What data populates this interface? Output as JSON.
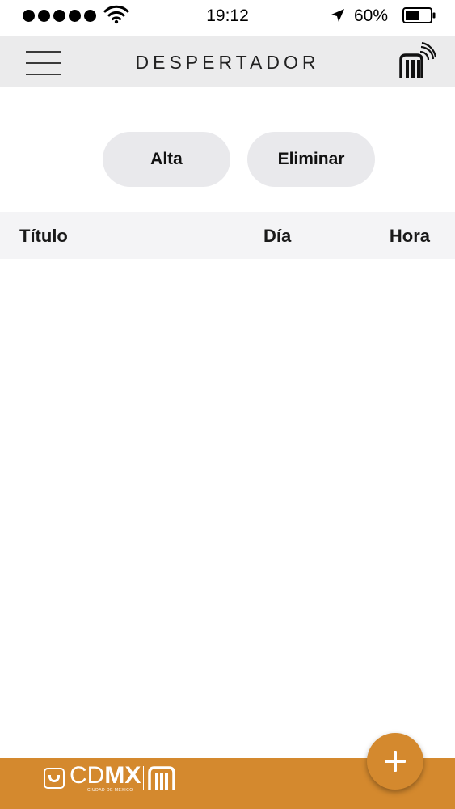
{
  "status_bar": {
    "signal_dots": 5,
    "time": "19:12",
    "battery_percent": "60%",
    "battery_level": 0.6,
    "icons": [
      "signal-dots-icon",
      "wifi-icon",
      "location-arrow-icon",
      "battery-icon"
    ]
  },
  "nav_bar": {
    "title": "DESPERTADOR",
    "menu_icon": "hamburger-menu-icon",
    "logo_icon": "metro-logo-icon",
    "background": "#ebebec"
  },
  "actions": {
    "alta_label": "Alta",
    "eliminar_label": "Eliminar"
  },
  "table": {
    "columns": [
      "Título",
      "Día",
      "Hora"
    ],
    "rows": []
  },
  "footer": {
    "logo_text_light": "CD",
    "logo_text_bold": "MX",
    "logo_subtitle": "CIUDAD DE MÉXICO",
    "background": "#d4892e"
  },
  "fab": {
    "label": "+",
    "icon": "plus-icon",
    "color": "#d4892e"
  }
}
